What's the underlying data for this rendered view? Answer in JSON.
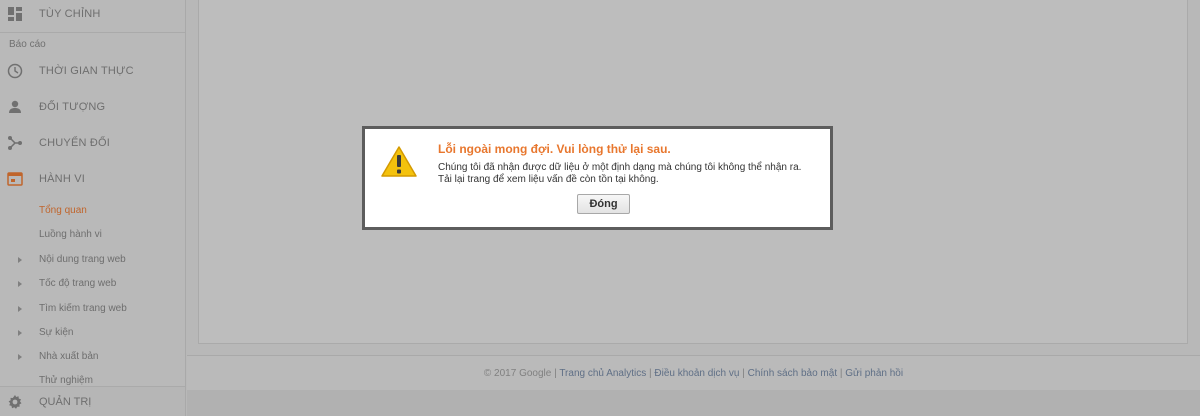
{
  "sidebar": {
    "customize_label": "TÙY CHỈNH",
    "section_label": "Báo cáo",
    "items": [
      {
        "label": "THỜI GIAN THỰC",
        "icon": "clock-icon"
      },
      {
        "label": "ĐỐI TƯỢNG",
        "icon": "person-icon"
      },
      {
        "label": "CHUYỂN ĐỔI",
        "icon": "conversion-icon"
      },
      {
        "label": "HÀNH VI",
        "icon": "behavior-icon"
      }
    ],
    "sub_items": [
      {
        "label": "Tổng quan",
        "current": true
      },
      {
        "label": "Luồng hành vi"
      },
      {
        "label": "Nội dung trang web",
        "expandable": true
      },
      {
        "label": "Tốc độ trang web",
        "expandable": true
      },
      {
        "label": "Tìm kiếm trang web",
        "expandable": true
      },
      {
        "label": "Sự kiện",
        "expandable": true
      },
      {
        "label": "Nhà xuất bản",
        "expandable": true
      },
      {
        "label": "Thử nghiệm"
      }
    ],
    "admin_label": "QUẢN TRỊ"
  },
  "footer": {
    "copyright": "© 2017 Google",
    "links": [
      "Trang chủ Analytics",
      "Điều khoản dịch vụ",
      "Chính sách bảo mật",
      "Gửi phản hồi"
    ],
    "separator": " | "
  },
  "dialog": {
    "title": "Lỗi ngoài mong đợi. Vui lòng thử lại sau.",
    "message_line1": "Chúng tôi đã nhận được dữ liệu ở một định dạng mà chúng tôi không thể nhận ra.",
    "message_line2": "Tải lại trang để xem liệu vấn đề còn tồn tại không.",
    "close_label": "Đóng",
    "icon": "warning-icon"
  },
  "colors": {
    "accent_orange": "#e8772e",
    "current_item": "#c0652c",
    "overlay": "#b8b8b8"
  }
}
